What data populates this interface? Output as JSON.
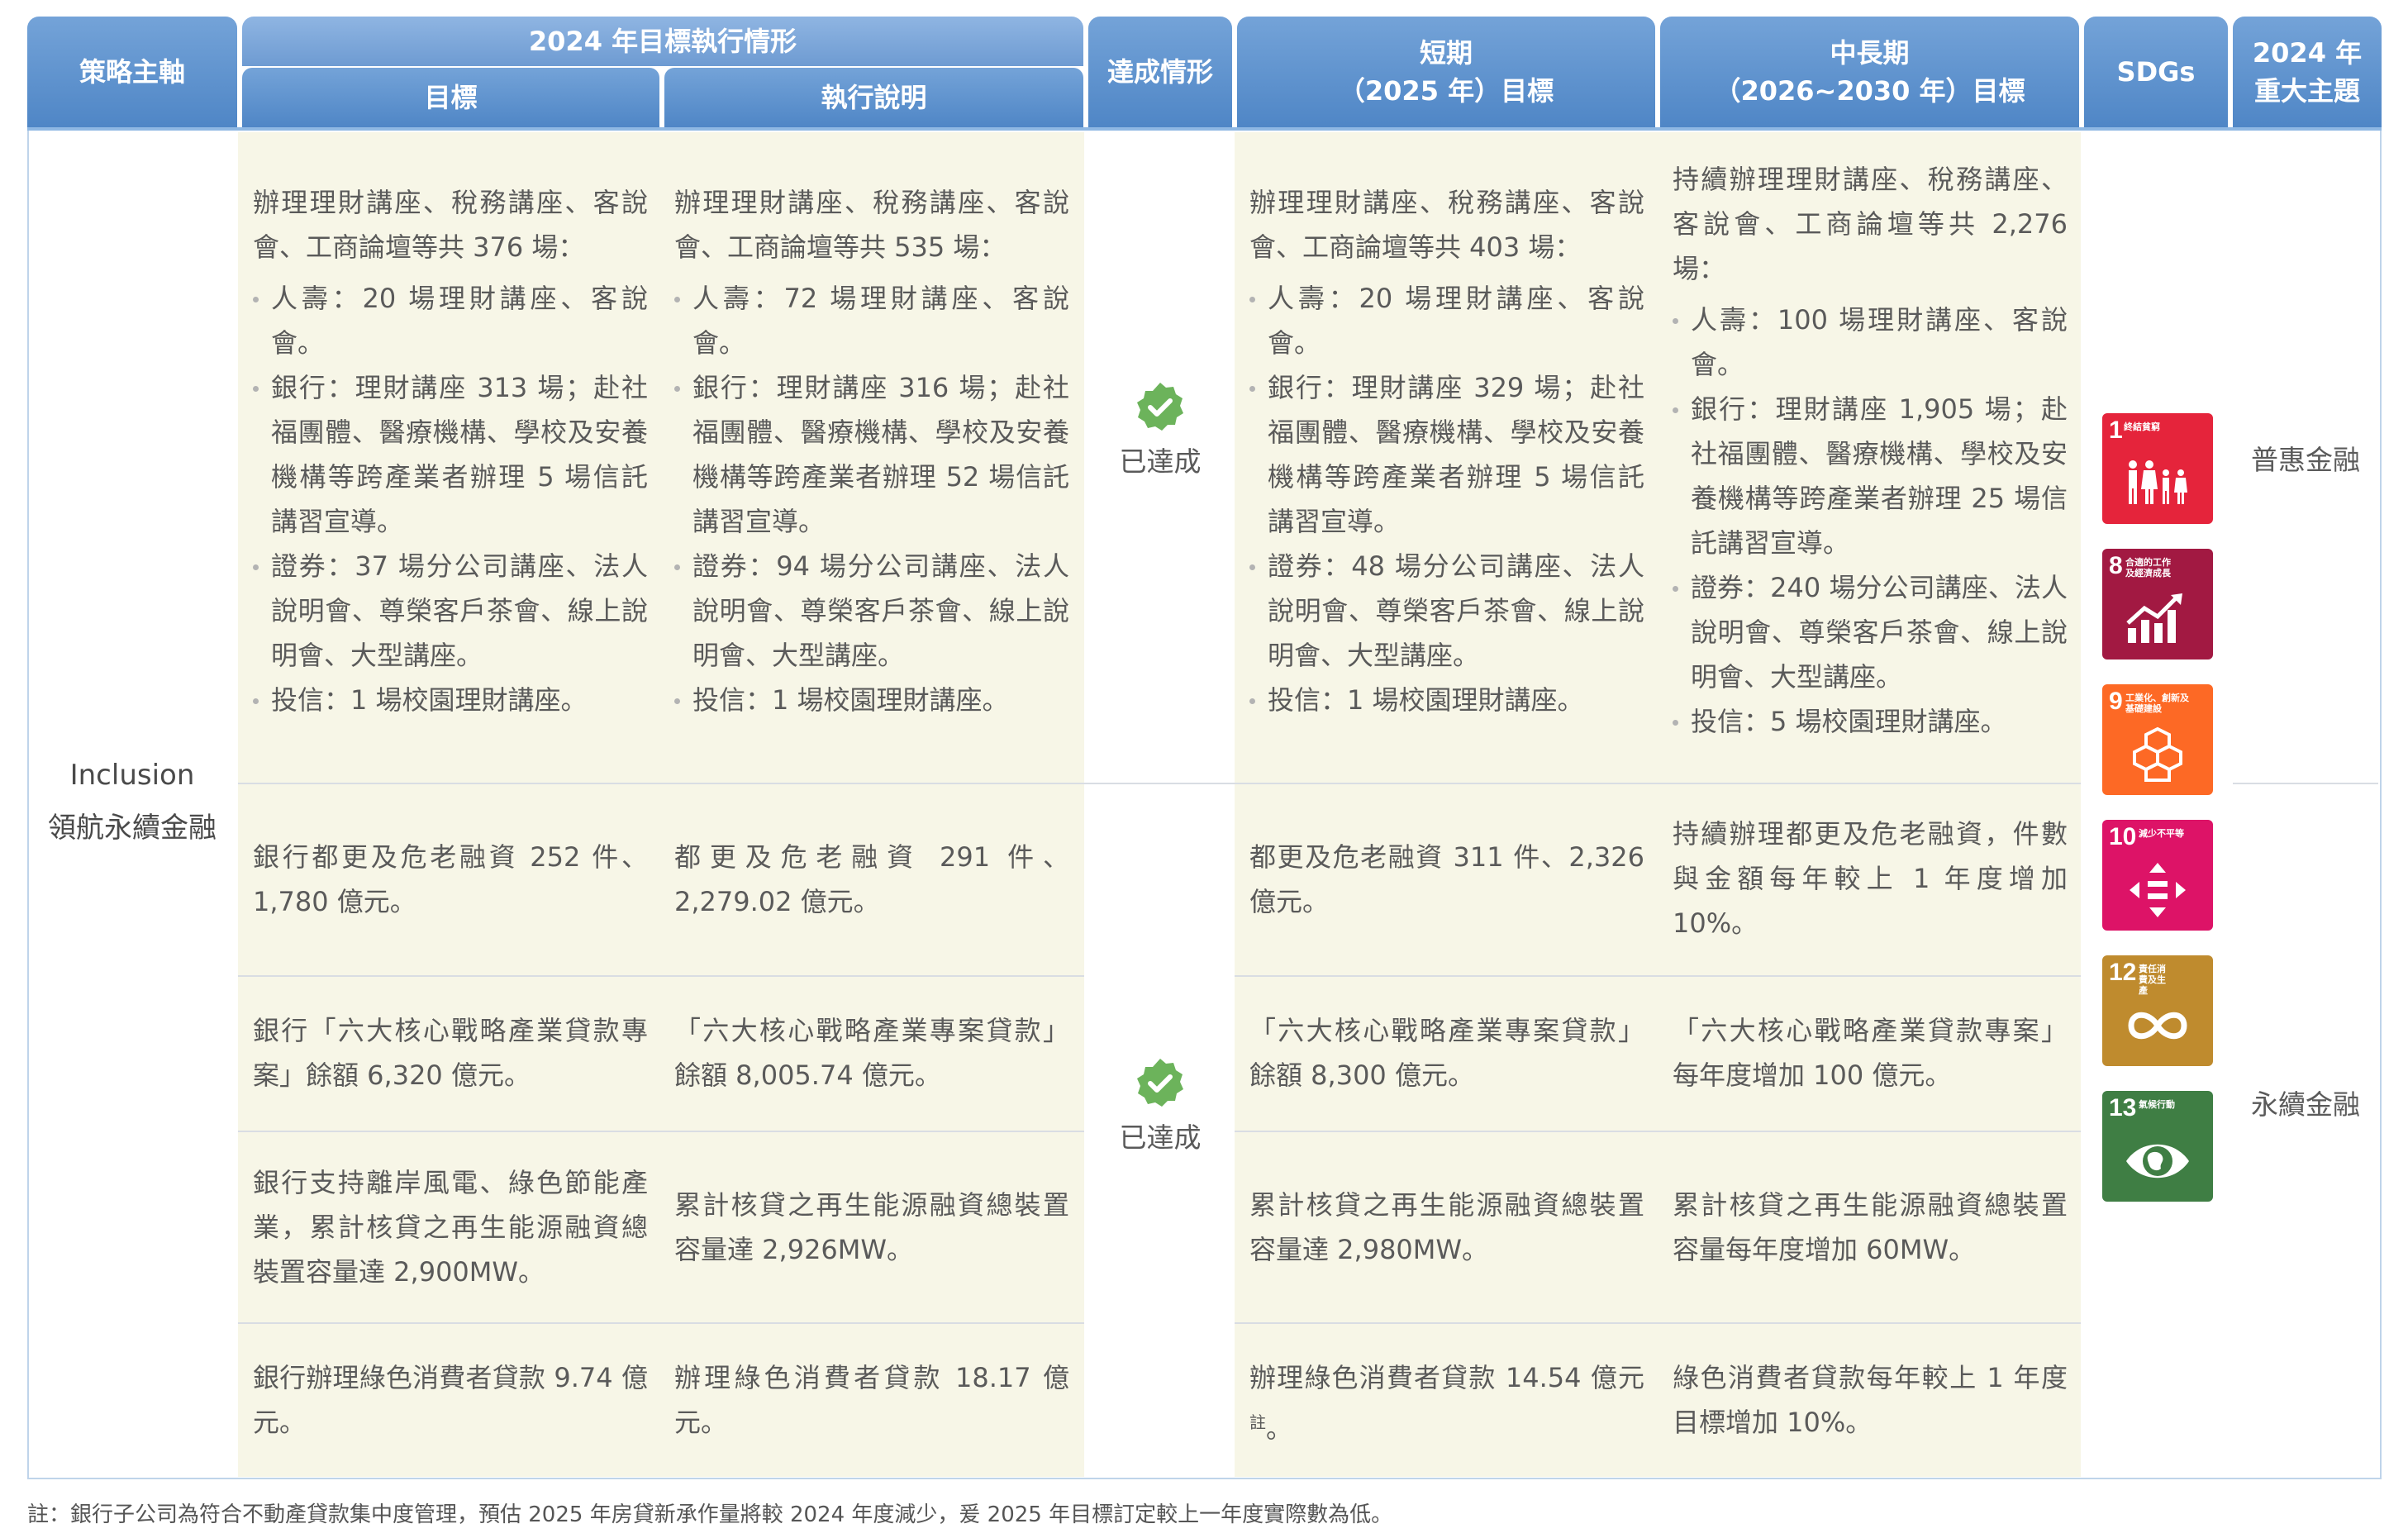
{
  "header": {
    "strategy_axis": "策略主軸",
    "execution_2024": "2024 年目標執行情形",
    "target": "目標",
    "execution_note": "執行說明",
    "achievement": "達成情形",
    "short_term_line1": "短期",
    "short_term_line2": "（2025 年）目標",
    "mid_long_line1": "中長期",
    "mid_long_line2": "（2026~2030 年）目標",
    "sdgs": "SDGs",
    "major_topic_line1": "2024 年",
    "major_topic_line2": "重大主題"
  },
  "axis": {
    "line1": "Inclusion",
    "line2": "領航永續金融"
  },
  "status_label": "已達成",
  "themes": [
    "普惠金融",
    "永續金融"
  ],
  "rows": [
    {
      "target": {
        "intro": "辦理理財講座、稅務講座、客說會、工商論壇等共 376 場：",
        "bullets": [
          "人壽：20 場理財講座、客說會。",
          "銀行：理財講座 313 場；赴社福團體、醫療機構、學校及安養機構等跨產業者辦理 5 場信託講習宣導。",
          "證券：37 場分公司講座、法人說明會、尊榮客戶茶會、線上說明會、大型講座。",
          "投信：1 場校園理財講座。"
        ]
      },
      "execution": {
        "intro": "辦理理財講座、稅務講座、客說會、工商論壇等共 535 場：",
        "bullets": [
          "人壽：72 場理財講座、客說會。",
          "銀行：理財講座 316 場；赴社福團體、醫療機構、學校及安養機構等跨產業者辦理 52 場信託講習宣導。",
          "證券：94 場分公司講座、法人說明會、尊榮客戶茶會、線上說明會、大型講座。",
          "投信：1 場校園理財講座。"
        ]
      },
      "short": {
        "intro": "辦理理財講座、稅務講座、客說會、工商論壇等共 403 場：",
        "bullets": [
          "人壽：20 場理財講座、客說會。",
          "銀行：理財講座 329 場；赴社福團體、醫療機構、學校及安養機構等跨產業者辦理 5 場信託講習宣導。",
          "證券：48 場分公司講座、法人說明會、尊榮客戶茶會、線上說明會、大型講座。",
          "投信：1 場校園理財講座。"
        ]
      },
      "midlong": {
        "intro": "持續辦理理財講座、稅務講座、客說會、工商論壇等共 2,276 場：",
        "bullets": [
          "人壽：100 場理財講座、客說會。",
          "銀行：理財講座 1,905 場；赴社福團體、醫療機構、學校及安養機構等跨產業者辦理 25 場信託講習宣導。",
          "證券：240 場分公司講座、法人說明會、尊榮客戶茶會、線上說明會、大型講座。",
          "投信：5 場校園理財講座。"
        ]
      }
    },
    {
      "target": "銀行都更及危老融資 252 件、1,780 億元。",
      "execution": "都更及危老融資 291 件、2,279.02 億元。",
      "short": "都更及危老融資 311 件、2,326 億元。",
      "midlong": "持續辦理都更及危老融資，件數與金額每年較上 1 年度增加 10%。"
    },
    {
      "target": "銀行「六大核心戰略產業貸款專案」餘額 6,320 億元。",
      "execution": "「六大核心戰略產業專案貸款」餘額 8,005.74 億元。",
      "short": "「六大核心戰略產業專案貸款」餘額 8,300 億元。",
      "midlong": "「六大核心戰略產業貸款專案」每年度增加 100 億元。"
    },
    {
      "target": "銀行支持離岸風電、綠色節能產業，累計核貸之再生能源融資總裝置容量達 2,900MW。",
      "execution": "累計核貸之再生能源融資總裝置容量達 2,926MW。",
      "short": "累計核貸之再生能源融資總裝置容量達 2,980MW。",
      "midlong": "累計核貸之再生能源融資總裝置容量每年度增加 60MW。"
    },
    {
      "target": "銀行辦理綠色消費者貸款 9.74 億元。",
      "execution": "辦理綠色消費者貸款 18.17 億元。",
      "short": "辦理綠色消費者貸款 14.54 億元",
      "short_sup": "註",
      "short_end": "。",
      "midlong": "綠色消費者貸款每年較上 1 年度目標增加 10%。"
    }
  ],
  "sdgs": [
    {
      "number": "1",
      "label": "終結貧窮",
      "icon": "family-icon",
      "color": "#e5243b"
    },
    {
      "number": "8",
      "label": "合適的工作及經濟成長",
      "icon": "growth-chart-icon",
      "color": "#a21942"
    },
    {
      "number": "9",
      "label": "工業化、創新及基礎建設",
      "icon": "cubes-icon",
      "color": "#fd6925"
    },
    {
      "number": "10",
      "label": "減少不平等",
      "icon": "equality-icon",
      "color": "#dd1367"
    },
    {
      "number": "12",
      "label": "責任消費及生產",
      "icon": "infinity-icon",
      "color": "#bf8b2e"
    },
    {
      "number": "13",
      "label": "氣候行動",
      "icon": "eye-globe-icon",
      "color": "#3f7e44"
    }
  ],
  "footnote": "註：銀行子公司為符合不動產貸款集中度管理，預估 2025 年房貸新承作量將較 2024 年度減少，爰 2025 年目標訂定較上一年度實際數為低。"
}
